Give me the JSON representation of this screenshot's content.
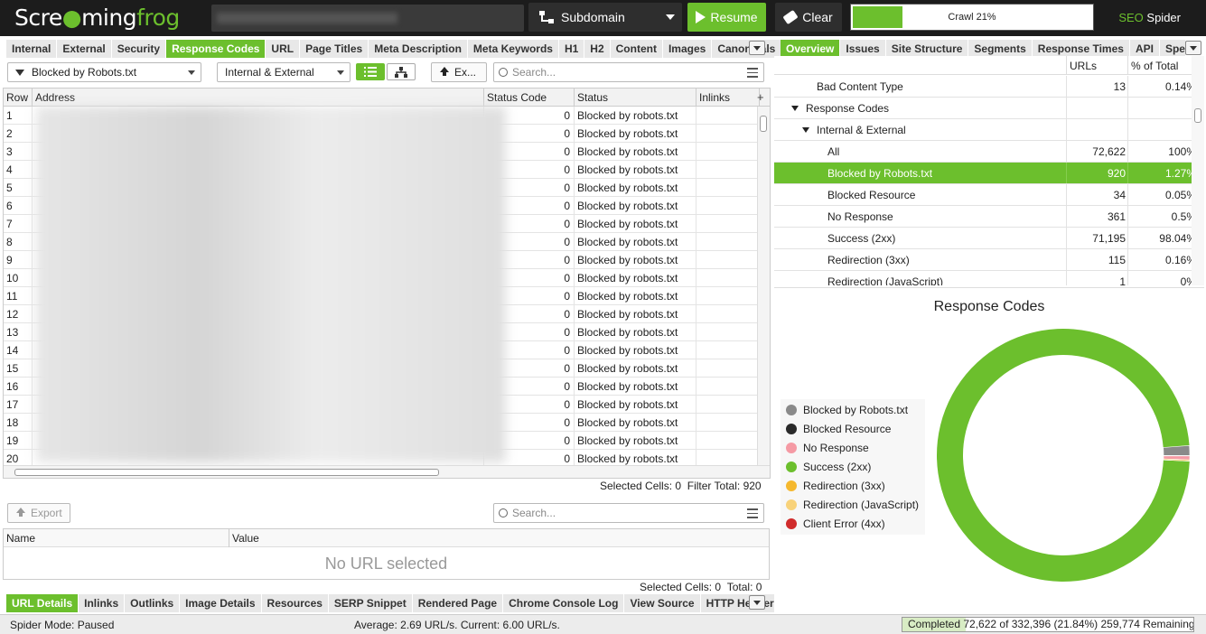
{
  "app": {
    "logo_prefix": "Scre",
    "logo_mid": "ming",
    "logo_suffix": "frog",
    "brand_seo": "SEO",
    "brand_spider": " Spider",
    "accent_color": "#6cbf2d"
  },
  "toolbar": {
    "mode_label": "Subdomain",
    "resume_label": "Resume",
    "clear_label": "Clear",
    "crawl_label": "Crawl 21%",
    "crawl_progress": 0.21
  },
  "left_tabs": [
    "Internal",
    "External",
    "Security",
    "Response Codes",
    "URL",
    "Page Titles",
    "Meta Description",
    "Meta Keywords",
    "H1",
    "H2",
    "Content",
    "Images",
    "Canonicals"
  ],
  "left_active_tab": "Response Codes",
  "filter": {
    "selected": "Blocked by Robots.txt",
    "scope": "Internal & External",
    "export_label": "Ex...",
    "search_placeholder": "Search..."
  },
  "grid": {
    "columns": [
      "Row",
      "Address",
      "Status Code",
      "Status",
      "Inlinks"
    ],
    "rows": [
      {
        "row": "1",
        "code": "0",
        "status": "Blocked by robots.txt"
      },
      {
        "row": "2",
        "code": "0",
        "status": "Blocked by robots.txt"
      },
      {
        "row": "3",
        "code": "0",
        "status": "Blocked by robots.txt"
      },
      {
        "row": "4",
        "code": "0",
        "status": "Blocked by robots.txt"
      },
      {
        "row": "5",
        "code": "0",
        "status": "Blocked by robots.txt"
      },
      {
        "row": "6",
        "code": "0",
        "status": "Blocked by robots.txt"
      },
      {
        "row": "7",
        "code": "0",
        "status": "Blocked by robots.txt"
      },
      {
        "row": "8",
        "code": "0",
        "status": "Blocked by robots.txt"
      },
      {
        "row": "9",
        "code": "0",
        "status": "Blocked by robots.txt"
      },
      {
        "row": "10",
        "code": "0",
        "status": "Blocked by robots.txt"
      },
      {
        "row": "11",
        "code": "0",
        "status": "Blocked by robots.txt"
      },
      {
        "row": "12",
        "code": "0",
        "status": "Blocked by robots.txt"
      },
      {
        "row": "13",
        "code": "0",
        "status": "Blocked by robots.txt"
      },
      {
        "row": "14",
        "code": "0",
        "status": "Blocked by robots.txt"
      },
      {
        "row": "15",
        "code": "0",
        "status": "Blocked by robots.txt"
      },
      {
        "row": "16",
        "code": "0",
        "status": "Blocked by robots.txt"
      },
      {
        "row": "17",
        "code": "0",
        "status": "Blocked by robots.txt"
      },
      {
        "row": "18",
        "code": "0",
        "status": "Blocked by robots.txt"
      },
      {
        "row": "19",
        "code": "0",
        "status": "Blocked by robots.txt"
      },
      {
        "row": "20",
        "code": "0",
        "status": "Blocked by robots.txt"
      }
    ],
    "selected_cells_label": "Selected Cells:",
    "selected_cells_value": "0",
    "filter_total_label": "Filter Total:",
    "filter_total_value": "920"
  },
  "lower": {
    "export_label": "Export",
    "search_placeholder": "Search...",
    "columns": [
      "Name",
      "Value"
    ],
    "empty_text": "No URL selected",
    "selected_cells_label": "Selected Cells:",
    "selected_cells_value": "0",
    "total_label": "Total:",
    "total_value": "0"
  },
  "bottom_tabs": [
    "URL Details",
    "Inlinks",
    "Outlinks",
    "Image Details",
    "Resources",
    "SERP Snippet",
    "Rendered Page",
    "Chrome Console Log",
    "View Source",
    "HTTP Headers"
  ],
  "bottom_active_tab": "URL Details",
  "right_tabs": [
    "Overview",
    "Issues",
    "Site Structure",
    "Segments",
    "Response Times",
    "API",
    "Spelling"
  ],
  "right_active_tab": "Overview",
  "overview": {
    "col_urls": "URLs",
    "col_pct": "% of Total",
    "rows": [
      {
        "label": "Bad Content Type",
        "urls": "13",
        "pct": "0.14%",
        "indent": 0,
        "expander": false,
        "selected": false
      },
      {
        "label": "Response Codes",
        "urls": "",
        "pct": "",
        "indent": 1,
        "expander": true,
        "selected": false
      },
      {
        "label": "Internal & External",
        "urls": "",
        "pct": "",
        "indent": 2,
        "expander": true,
        "selected": false
      },
      {
        "label": "All",
        "urls": "72,622",
        "pct": "100%",
        "indent": 3,
        "expander": false,
        "selected": false
      },
      {
        "label": "Blocked by Robots.txt",
        "urls": "920",
        "pct": "1.27%",
        "indent": 3,
        "expander": false,
        "selected": true
      },
      {
        "label": "Blocked Resource",
        "urls": "34",
        "pct": "0.05%",
        "indent": 3,
        "expander": false,
        "selected": false
      },
      {
        "label": "No Response",
        "urls": "361",
        "pct": "0.5%",
        "indent": 3,
        "expander": false,
        "selected": false
      },
      {
        "label": "Success (2xx)",
        "urls": "71,195",
        "pct": "98.04%",
        "indent": 3,
        "expander": false,
        "selected": false
      },
      {
        "label": "Redirection (3xx)",
        "urls": "115",
        "pct": "0.16%",
        "indent": 3,
        "expander": false,
        "selected": false
      },
      {
        "label": "Redirection (JavaScript)",
        "urls": "1",
        "pct": "0%",
        "indent": 3,
        "expander": false,
        "selected": false
      }
    ]
  },
  "chart_data": {
    "type": "pie",
    "title": "Response Codes",
    "legend_position": "left",
    "series": [
      {
        "name": "Blocked by Robots.txt",
        "value": 920,
        "color": "#8a8a8a"
      },
      {
        "name": "Blocked Resource",
        "value": 34,
        "color": "#2a2a2a"
      },
      {
        "name": "No Response",
        "value": 361,
        "color": "#f59aa4"
      },
      {
        "name": "Success (2xx)",
        "value": 71195,
        "color": "#6cbf2d"
      },
      {
        "name": "Redirection (3xx)",
        "value": 115,
        "color": "#f5b82e"
      },
      {
        "name": "Redirection (JavaScript)",
        "value": 1,
        "color": "#f8d27a"
      },
      {
        "name": "Client Error (4xx)",
        "value": 0,
        "color": "#d02b2b"
      }
    ]
  },
  "status_bar": {
    "mode": "Spider Mode: Paused",
    "average": "Average: 2.69 URL/s. Current: 6.00 URL/s.",
    "completed_prefix": "Completed",
    "completed_rest": "72,622 of 332,396 (21.84%) 259,774 Remaining",
    "completed_progress": 0.2184
  }
}
